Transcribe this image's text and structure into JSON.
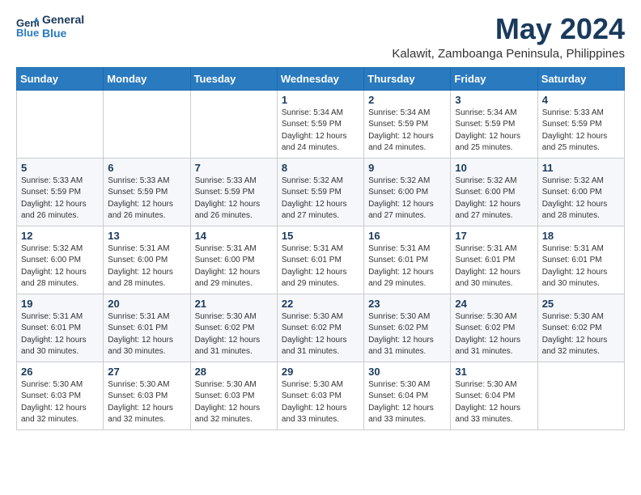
{
  "logo": {
    "line1": "General",
    "line2": "Blue"
  },
  "title": {
    "month": "May 2024",
    "location": "Kalawit, Zamboanga Peninsula, Philippines"
  },
  "headers": [
    "Sunday",
    "Monday",
    "Tuesday",
    "Wednesday",
    "Thursday",
    "Friday",
    "Saturday"
  ],
  "weeks": [
    [
      {
        "day": "",
        "info": ""
      },
      {
        "day": "",
        "info": ""
      },
      {
        "day": "",
        "info": ""
      },
      {
        "day": "1",
        "info": "Sunrise: 5:34 AM\nSunset: 5:59 PM\nDaylight: 12 hours\nand 24 minutes."
      },
      {
        "day": "2",
        "info": "Sunrise: 5:34 AM\nSunset: 5:59 PM\nDaylight: 12 hours\nand 24 minutes."
      },
      {
        "day": "3",
        "info": "Sunrise: 5:34 AM\nSunset: 5:59 PM\nDaylight: 12 hours\nand 25 minutes."
      },
      {
        "day": "4",
        "info": "Sunrise: 5:33 AM\nSunset: 5:59 PM\nDaylight: 12 hours\nand 25 minutes."
      }
    ],
    [
      {
        "day": "5",
        "info": "Sunrise: 5:33 AM\nSunset: 5:59 PM\nDaylight: 12 hours\nand 26 minutes."
      },
      {
        "day": "6",
        "info": "Sunrise: 5:33 AM\nSunset: 5:59 PM\nDaylight: 12 hours\nand 26 minutes."
      },
      {
        "day": "7",
        "info": "Sunrise: 5:33 AM\nSunset: 5:59 PM\nDaylight: 12 hours\nand 26 minutes."
      },
      {
        "day": "8",
        "info": "Sunrise: 5:32 AM\nSunset: 5:59 PM\nDaylight: 12 hours\nand 27 minutes."
      },
      {
        "day": "9",
        "info": "Sunrise: 5:32 AM\nSunset: 6:00 PM\nDaylight: 12 hours\nand 27 minutes."
      },
      {
        "day": "10",
        "info": "Sunrise: 5:32 AM\nSunset: 6:00 PM\nDaylight: 12 hours\nand 27 minutes."
      },
      {
        "day": "11",
        "info": "Sunrise: 5:32 AM\nSunset: 6:00 PM\nDaylight: 12 hours\nand 28 minutes."
      }
    ],
    [
      {
        "day": "12",
        "info": "Sunrise: 5:32 AM\nSunset: 6:00 PM\nDaylight: 12 hours\nand 28 minutes."
      },
      {
        "day": "13",
        "info": "Sunrise: 5:31 AM\nSunset: 6:00 PM\nDaylight: 12 hours\nand 28 minutes."
      },
      {
        "day": "14",
        "info": "Sunrise: 5:31 AM\nSunset: 6:00 PM\nDaylight: 12 hours\nand 29 minutes."
      },
      {
        "day": "15",
        "info": "Sunrise: 5:31 AM\nSunset: 6:01 PM\nDaylight: 12 hours\nand 29 minutes."
      },
      {
        "day": "16",
        "info": "Sunrise: 5:31 AM\nSunset: 6:01 PM\nDaylight: 12 hours\nand 29 minutes."
      },
      {
        "day": "17",
        "info": "Sunrise: 5:31 AM\nSunset: 6:01 PM\nDaylight: 12 hours\nand 30 minutes."
      },
      {
        "day": "18",
        "info": "Sunrise: 5:31 AM\nSunset: 6:01 PM\nDaylight: 12 hours\nand 30 minutes."
      }
    ],
    [
      {
        "day": "19",
        "info": "Sunrise: 5:31 AM\nSunset: 6:01 PM\nDaylight: 12 hours\nand 30 minutes."
      },
      {
        "day": "20",
        "info": "Sunrise: 5:31 AM\nSunset: 6:01 PM\nDaylight: 12 hours\nand 30 minutes."
      },
      {
        "day": "21",
        "info": "Sunrise: 5:30 AM\nSunset: 6:02 PM\nDaylight: 12 hours\nand 31 minutes."
      },
      {
        "day": "22",
        "info": "Sunrise: 5:30 AM\nSunset: 6:02 PM\nDaylight: 12 hours\nand 31 minutes."
      },
      {
        "day": "23",
        "info": "Sunrise: 5:30 AM\nSunset: 6:02 PM\nDaylight: 12 hours\nand 31 minutes."
      },
      {
        "day": "24",
        "info": "Sunrise: 5:30 AM\nSunset: 6:02 PM\nDaylight: 12 hours\nand 31 minutes."
      },
      {
        "day": "25",
        "info": "Sunrise: 5:30 AM\nSunset: 6:02 PM\nDaylight: 12 hours\nand 32 minutes."
      }
    ],
    [
      {
        "day": "26",
        "info": "Sunrise: 5:30 AM\nSunset: 6:03 PM\nDaylight: 12 hours\nand 32 minutes."
      },
      {
        "day": "27",
        "info": "Sunrise: 5:30 AM\nSunset: 6:03 PM\nDaylight: 12 hours\nand 32 minutes."
      },
      {
        "day": "28",
        "info": "Sunrise: 5:30 AM\nSunset: 6:03 PM\nDaylight: 12 hours\nand 32 minutes."
      },
      {
        "day": "29",
        "info": "Sunrise: 5:30 AM\nSunset: 6:03 PM\nDaylight: 12 hours\nand 33 minutes."
      },
      {
        "day": "30",
        "info": "Sunrise: 5:30 AM\nSunset: 6:04 PM\nDaylight: 12 hours\nand 33 minutes."
      },
      {
        "day": "31",
        "info": "Sunrise: 5:30 AM\nSunset: 6:04 PM\nDaylight: 12 hours\nand 33 minutes."
      },
      {
        "day": "",
        "info": ""
      }
    ]
  ]
}
